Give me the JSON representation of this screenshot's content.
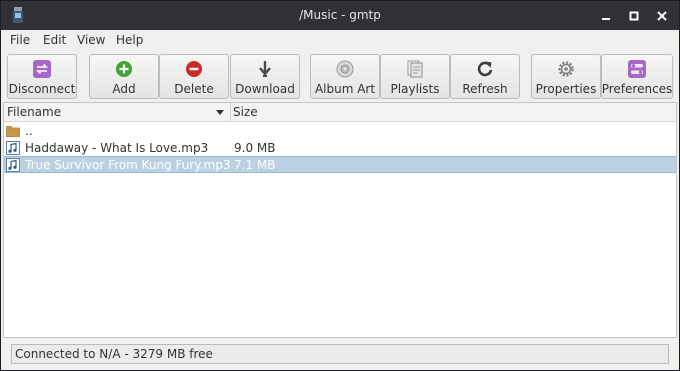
{
  "window": {
    "title": "/Music - gmtp"
  },
  "menu": [
    "File",
    "Edit",
    "View",
    "Help"
  ],
  "toolbar": {
    "disconnect": "Disconnect",
    "add": "Add",
    "delete": "Delete",
    "download": "Download",
    "album_art": "Album Art",
    "playlists": "Playlists",
    "refresh": "Refresh",
    "properties": "Properties",
    "preferences": "Preferences"
  },
  "columns": {
    "filename": "Filename",
    "size": "Size"
  },
  "files": [
    {
      "name": "..",
      "size": "",
      "type": "folder"
    },
    {
      "name": "Haddaway - What Is Love.mp3",
      "size": "9.0 MB",
      "type": "audio"
    },
    {
      "name": "True Survivor From Kung Fury.mp3",
      "size": "7.1 MB",
      "type": "audio",
      "selected": true
    }
  ],
  "status": {
    "text": "Connected to N/A - 3279 MB free"
  },
  "colors": {
    "selection": "#bcd0e3",
    "titlebar": "#2f3136",
    "add_green": "#3fa336",
    "delete_red": "#cc2a2a",
    "disconnect_purple": "#a668c8"
  }
}
